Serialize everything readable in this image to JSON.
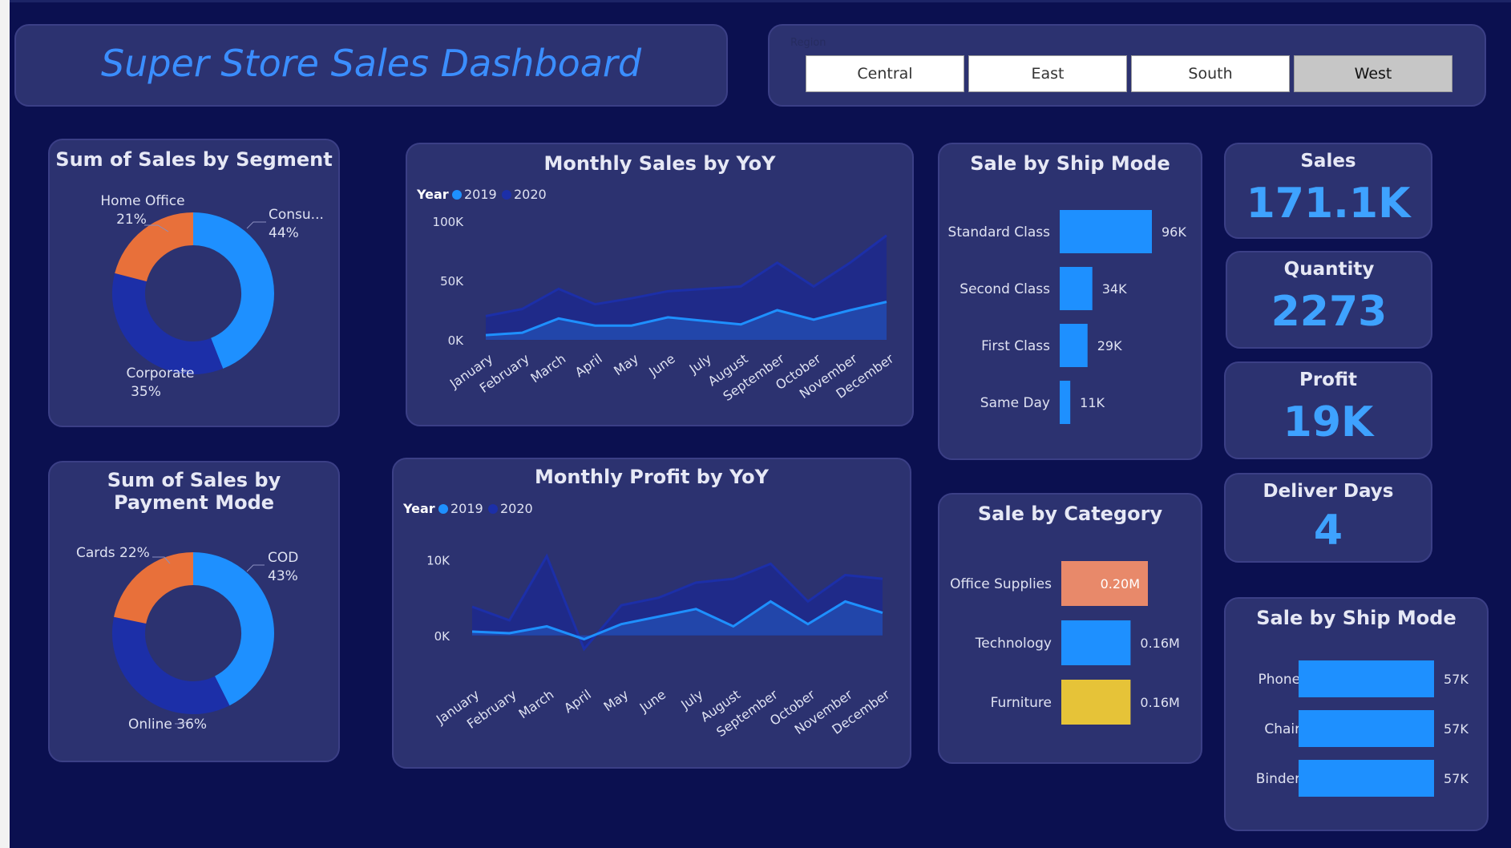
{
  "dashboard_title": "Super Store Sales Dashboard",
  "region_slicer": {
    "label": "Region",
    "options": [
      "Central",
      "East",
      "South",
      "West"
    ],
    "selected": "West"
  },
  "colors": {
    "blue": "#1e90ff",
    "dark_blue": "#1c2fa8",
    "orange": "#e8703a",
    "salmon": "#e8896a",
    "yellow": "#e6c338",
    "bg": "#0b1050",
    "card": "#2c3270"
  },
  "kpis": {
    "sales": {
      "label": "Sales",
      "value": "171.1K"
    },
    "quantity": {
      "label": "Quantity",
      "value": "2273"
    },
    "profit": {
      "label": "Profit",
      "value": "19K"
    },
    "deliver_days": {
      "label": "Deliver Days",
      "value": "4"
    }
  },
  "chart_data": [
    {
      "id": "segment_donut",
      "type": "pie",
      "title": "Sum of Sales by Segment",
      "slices": [
        {
          "label": "Consu...",
          "percent": 44,
          "percent_label": "44%",
          "color": "#1e90ff"
        },
        {
          "label": "Corporate",
          "percent": 35,
          "percent_label": "35%",
          "color": "#1c2fa8"
        },
        {
          "label": "Home Office",
          "percent": 21,
          "percent_label": "21%",
          "color": "#e8703a"
        }
      ]
    },
    {
      "id": "payment_donut",
      "type": "pie",
      "title": "Sum of Sales by Payment Mode",
      "slices": [
        {
          "label": "COD",
          "percent": 43,
          "percent_label": "43%",
          "color": "#1e90ff"
        },
        {
          "label": "Online",
          "percent": 36,
          "percent_label": "36%",
          "color": "#1c2fa8"
        },
        {
          "label": "Cards",
          "percent": 22,
          "percent_label": "22%",
          "color": "#e8703a"
        }
      ]
    },
    {
      "id": "monthly_sales",
      "type": "area",
      "title": "Monthly Sales by YoY",
      "legend_title": "Year",
      "categories": [
        "January",
        "February",
        "March",
        "April",
        "May",
        "June",
        "July",
        "August",
        "September",
        "October",
        "November",
        "December"
      ],
      "series": [
        {
          "name": "2019",
          "color": "#1e90ff",
          "values": [
            4,
            6,
            18,
            12,
            12,
            19,
            16,
            13,
            25,
            17,
            25,
            32
          ]
        },
        {
          "name": "2020",
          "color": "#1c2fa8",
          "values": [
            20,
            26,
            43,
            30,
            35,
            41,
            43,
            45,
            65,
            45,
            65,
            88
          ]
        }
      ],
      "ylim": [
        0,
        100
      ],
      "yticks": [
        {
          "v": 0,
          "label": "0K"
        },
        {
          "v": 50,
          "label": "50K"
        },
        {
          "v": 100,
          "label": "100K"
        }
      ]
    },
    {
      "id": "monthly_profit",
      "type": "area",
      "title": "Monthly Profit by YoY",
      "legend_title": "Year",
      "categories": [
        "January",
        "February",
        "March",
        "April",
        "May",
        "June",
        "July",
        "August",
        "September",
        "October",
        "November",
        "December"
      ],
      "series": [
        {
          "name": "2019",
          "color": "#1e90ff",
          "values": [
            0.5,
            0.3,
            1.2,
            -0.5,
            1.5,
            2.5,
            3.5,
            1.2,
            4.5,
            1.5,
            4.5,
            3
          ]
        },
        {
          "name": "2020",
          "color": "#1c2fa8",
          "values": [
            3.8,
            2,
            10.5,
            -1.8,
            4,
            5,
            7,
            7.5,
            9.5,
            4.5,
            8,
            7.5
          ]
        }
      ],
      "ylim": [
        -3,
        14
      ],
      "yticks": [
        {
          "v": 0,
          "label": "0K"
        },
        {
          "v": 10,
          "label": "10K"
        }
      ]
    },
    {
      "id": "ship_mode",
      "type": "bar",
      "title": "Sale by Ship Mode",
      "categories": [
        "Standard Class",
        "Second Class",
        "First Class",
        "Same Day"
      ],
      "values": [
        96,
        34,
        29,
        11
      ],
      "labels": [
        "96K",
        "34K",
        "29K",
        "11K"
      ]
    },
    {
      "id": "category",
      "type": "bar",
      "title": "Sale by Category",
      "categories": [
        "Office Supplies",
        "Technology",
        "Furniture"
      ],
      "values": [
        0.2,
        0.16,
        0.16
      ],
      "labels": [
        "0.20M",
        "0.16M",
        "0.16M"
      ],
      "colors": [
        "#e8896a",
        "#1e90ff",
        "#e6c338"
      ]
    },
    {
      "id": "sub_category",
      "type": "bar",
      "title": "Sale by Ship Mode",
      "categories": [
        "Phones",
        "Chairs",
        "Binders"
      ],
      "values": [
        57,
        57,
        57
      ],
      "labels": [
        "57K",
        "57K",
        "57K"
      ]
    }
  ]
}
